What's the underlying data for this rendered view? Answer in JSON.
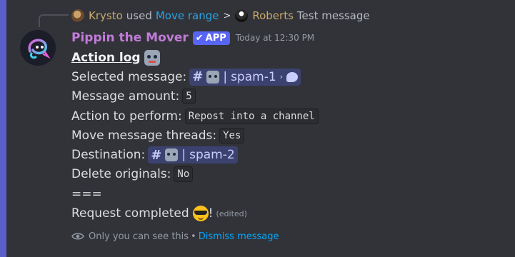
{
  "reply": {
    "user": "Krysto",
    "used_text": "used",
    "command": "Move range",
    "chevron": ">",
    "target_user": "Roberts",
    "target_message": "Test message"
  },
  "message": {
    "author": "Pippin the Mover",
    "badge_check": "✔",
    "badge": "APP",
    "timestamp": "Today at 12:30 PM",
    "title": "Action log",
    "lines": {
      "selected_label": "Selected message:",
      "selected_channel_hash": "#",
      "selected_channel_sep": "|",
      "selected_channel_name": "spam-1",
      "selected_channel_chevron": "›",
      "amount_label": "Message amount:",
      "amount_value": "5",
      "action_label": "Action to perform:",
      "action_value": "Repost into a channel",
      "threads_label": "Move message threads:",
      "threads_value": "Yes",
      "destination_label": "Destination:",
      "destination_hash": "#",
      "destination_sep": "|",
      "destination_name": "spam-2",
      "delete_label": "Delete originals:",
      "delete_value": "No",
      "separator": "===",
      "completed_text": "Request completed",
      "exclaim": "!",
      "edited": "(edited)"
    }
  },
  "ephemeral": {
    "notice": "Only you can see this",
    "bullet": "•",
    "dismiss": "Dismiss message"
  },
  "colors": {
    "background": "#323339",
    "accent_bar": "#5b5fc7",
    "bot_name": "#c27bd9",
    "app_badge": "#5865f2",
    "mention_bg": "#3c4270",
    "link": "#00a8fc"
  },
  "icons": {
    "eye": "eye-icon",
    "robot": "robot-emoji",
    "cool": "sunglasses-emoji",
    "thread": "thread-bubble-icon"
  }
}
